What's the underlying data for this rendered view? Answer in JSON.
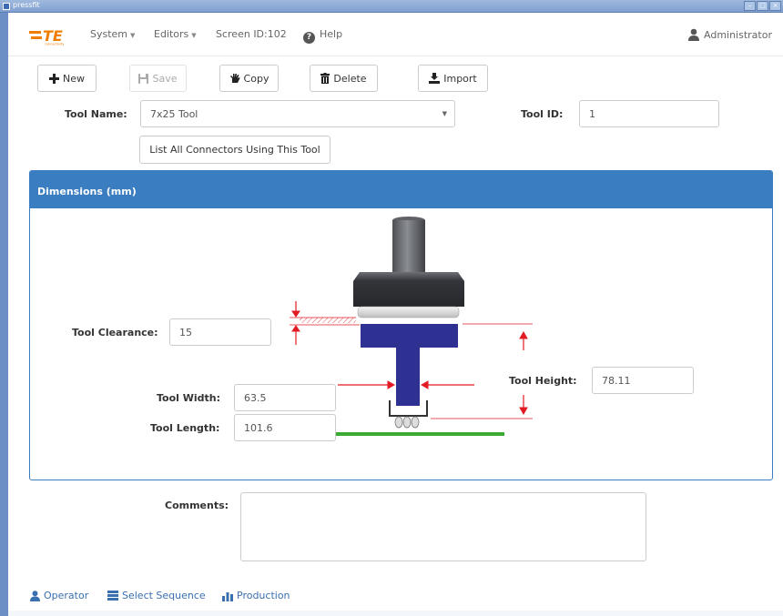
{
  "window": {
    "title": "pressfit"
  },
  "nav": {
    "brand": "TE",
    "brand_sub": "connectivity",
    "system": "System",
    "editors": "Editors",
    "screen_id": "Screen ID:102",
    "help": "Help",
    "user": "Administrator"
  },
  "toolbar": {
    "new": "New",
    "save": "Save",
    "copy": "Copy",
    "delete": "Delete",
    "import": "Import"
  },
  "form": {
    "tool_name_label": "Tool Name:",
    "tool_name_value": "7x25 Tool",
    "tool_id_label": "Tool ID:",
    "tool_id_value": "1",
    "list_connectors": "List All Connectors Using This Tool"
  },
  "dimensions": {
    "title": "Dimensions (mm)",
    "tool_clearance_label": "Tool Clearance:",
    "tool_clearance_value": "15",
    "tool_height_label": "Tool Height:",
    "tool_height_value": "78.11",
    "tool_width_label": "Tool Width:",
    "tool_width_value": "63.5",
    "tool_length_label": "Tool Length:",
    "tool_length_value": "101.6"
  },
  "comments": {
    "label": "Comments:",
    "value": ""
  },
  "footer": {
    "operator": "Operator",
    "select_sequence": "Select Sequence",
    "production": "Production"
  },
  "colors": {
    "accent": "#3a7dc0",
    "brand": "#f07d00",
    "tool_blue": "#2e3192",
    "dimension_red": "#e21b23",
    "board_green": "#3aaa35"
  }
}
